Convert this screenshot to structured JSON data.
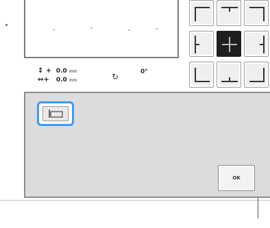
{
  "readout": {
    "vertical_symbol": "↕ +",
    "vertical_value": "0.0",
    "vertical_unit": "mm",
    "horizontal_symbol": "↔+",
    "horizontal_value": "0.0",
    "horizontal_unit": "mm",
    "rotate_symbol": "↻",
    "angle": "0°"
  },
  "position_grid": {
    "selected": "center",
    "items": [
      "top-left",
      "top-center",
      "top-right",
      "middle-left",
      "center",
      "middle-right",
      "bottom-left",
      "bottom-center",
      "bottom-right"
    ]
  },
  "buttons": {
    "ok_label": "OK"
  },
  "icons": {
    "layout": "align-left-frame-icon",
    "rotate": "rotate-icon"
  },
  "colors": {
    "highlight": "#3d9cf0",
    "selected_cell": "#1f1f1f",
    "panel_bg": "#dcdcdc"
  }
}
